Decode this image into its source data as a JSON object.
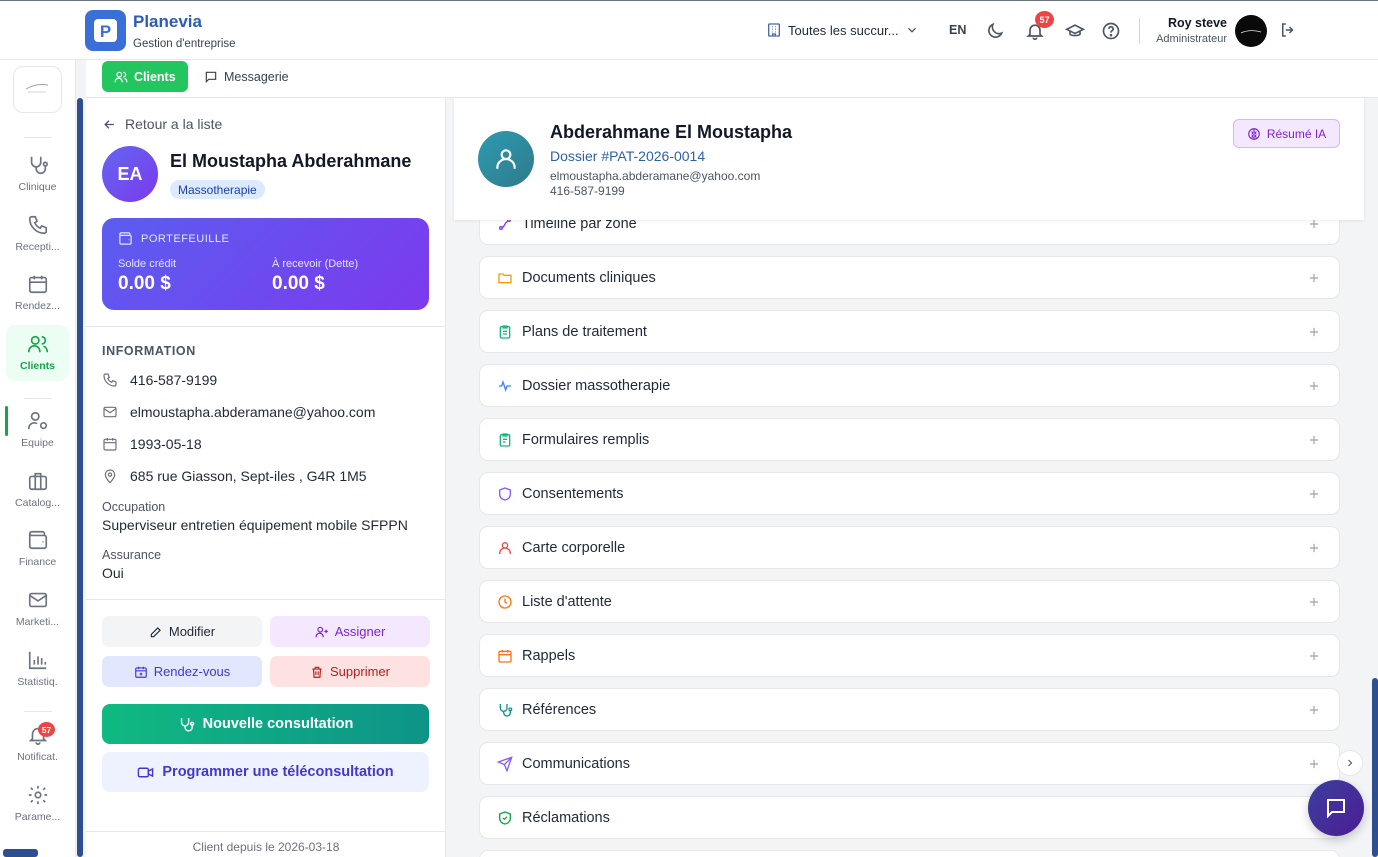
{
  "brand": {
    "name": "Planevia",
    "subtitle": "Gestion d'entreprise"
  },
  "header": {
    "branch_selector": "Toutes les succur...",
    "language": "EN",
    "notifications_count": "57",
    "user_name": "Roy steve",
    "user_role": "Administrateur"
  },
  "rail": {
    "items": [
      {
        "label": "Clinique",
        "icon": "stethoscope-icon"
      },
      {
        "label": "Recepti...",
        "icon": "phone-icon"
      },
      {
        "label": "Rendez...",
        "icon": "calendar-icon"
      },
      {
        "label": "Clients",
        "icon": "users-icon",
        "active": true
      },
      {
        "label": "Equipe",
        "icon": "user-gear-icon"
      },
      {
        "label": "Catalog...",
        "icon": "briefcase-icon"
      },
      {
        "label": "Finance",
        "icon": "wallet-icon"
      },
      {
        "label": "Marketi...",
        "icon": "mail-icon"
      },
      {
        "label": "Statistiq.",
        "icon": "bar-chart-icon"
      },
      {
        "label": "Notificat.",
        "icon": "bell-icon",
        "badge": "57"
      },
      {
        "label": "Parame...",
        "icon": "gear-icon"
      }
    ]
  },
  "tabs": [
    {
      "label": "Clients",
      "active": true
    },
    {
      "label": "Messagerie"
    }
  ],
  "patient_panel": {
    "back_label": "Retour a la liste",
    "initials": "EA",
    "name": "El Moustapha Abderahmane",
    "tag": "Massotherapie",
    "wallet": {
      "title": "PORTEFEUILLE",
      "credit_label": "Solde crédit",
      "credit_value": "0.00 $",
      "debt_label": "À recevoir (Dette)",
      "debt_value": "0.00 $"
    },
    "info_heading": "INFORMATION",
    "phone": "416-587-9199",
    "email": "elmoustapha.abderamane@yahoo.com",
    "birthdate": "1993-05-18",
    "address": "685 rue Giasson, Sept-iles , G4R 1M5",
    "occupation_label": "Occupation",
    "occupation_value": "Superviseur entretien équipement mobile SFPPN",
    "insurance_label": "Assurance",
    "insurance_value": "Oui",
    "actions": {
      "edit": "Modifier",
      "assign": "Assigner",
      "appointment": "Rendez-vous",
      "delete": "Supprimer",
      "new_consultation": "Nouvelle consultation",
      "teleconsultation": "Programmer une téléconsultation"
    },
    "client_since": "Client depuis le 2026-03-18"
  },
  "record_header": {
    "name": "Abderahmane El Moustapha",
    "dossier": "Dossier #PAT-2026-0014",
    "email": "elmoustapha.abderamane@yahoo.com",
    "phone": "416-587-9199",
    "ai_summary": "Résumé IA"
  },
  "sections": [
    {
      "label": "Timeline par zone",
      "icon": "timeline-icon",
      "color": "#7c3aed"
    },
    {
      "label": "Documents cliniques",
      "icon": "folder-icon",
      "color": "#f59e0b"
    },
    {
      "label": "Plans de traitement",
      "icon": "clipboard-icon",
      "color": "#10b981"
    },
    {
      "label": "Dossier massotherapie",
      "icon": "activity-icon",
      "color": "#3b82f6"
    },
    {
      "label": "Formulaires remplis",
      "icon": "clipboard-list-icon",
      "color": "#10b981"
    },
    {
      "label": "Consentements",
      "icon": "shield-icon",
      "color": "#8b5cf6"
    },
    {
      "label": "Carte corporelle",
      "icon": "user-icon",
      "color": "#ef4444"
    },
    {
      "label": "Liste d'attente",
      "icon": "clock-icon",
      "color": "#f97316"
    },
    {
      "label": "Rappels",
      "icon": "calendar-icon",
      "color": "#f97316"
    },
    {
      "label": "Références",
      "icon": "stethoscope-icon",
      "color": "#0d9488"
    },
    {
      "label": "Communications",
      "icon": "send-icon",
      "color": "#8b5cf6"
    },
    {
      "label": "Réclamations",
      "icon": "shield-check-icon",
      "color": "#16a34a"
    }
  ]
}
